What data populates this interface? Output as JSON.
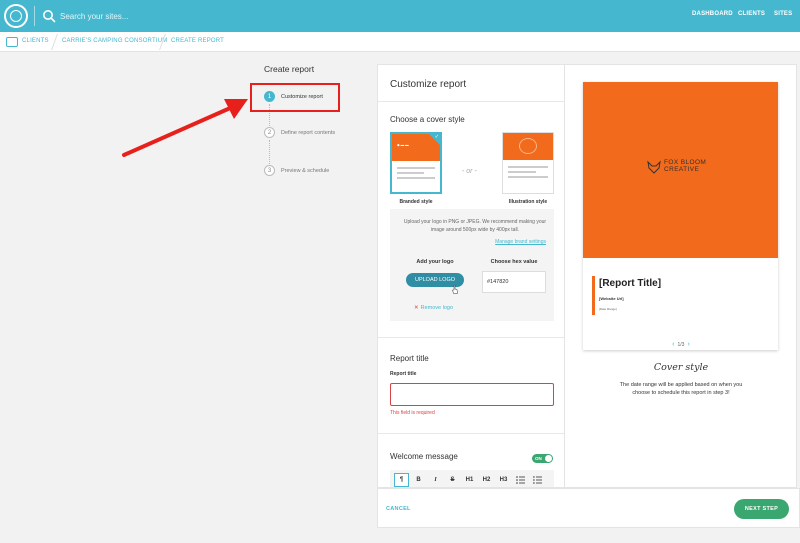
{
  "topbar": {
    "search_placeholder": "Search your sites...",
    "nav": [
      "DASHBOARD",
      "CLIENTS",
      "SITES"
    ]
  },
  "breadcrumb": [
    "CLIENTS",
    "CARRIE'S CAMPING CONSORTIUM",
    "CREATE REPORT"
  ],
  "steps": {
    "title": "Create report",
    "items": [
      {
        "num": "1",
        "label": "Customize report"
      },
      {
        "num": "2",
        "label": "Define report contents"
      },
      {
        "num": "3",
        "label": "Preview & schedule"
      }
    ]
  },
  "panel": {
    "title": "Customize report",
    "cover_section": "Choose a cover style",
    "or": "- or -",
    "branded_label": "Branded style",
    "illustration_label": "Illustration style",
    "logo_help": "Upload your logo in PNG or JPEG. We recommend making your image around 500px wide by 400px tall.",
    "manage_link": "Manage brand settings",
    "add_logo_label": "Add your logo",
    "hex_label": "Choose hex value",
    "upload_label": "UPLOAD LOGO",
    "hex_value": "#147820",
    "remove_logo": "Remove logo",
    "report_title_section": "Report title",
    "report_title_field": "Report title",
    "error": "This field is required",
    "welcome_section": "Welcome message",
    "toggle_label": "ON",
    "toolbar": [
      "¶",
      "B",
      "I",
      "S",
      "H1",
      "H2",
      "H3",
      "list",
      "numbered-list"
    ]
  },
  "footer": {
    "cancel": "CANCEL",
    "next": "NEXT STEP"
  },
  "preview": {
    "brand_line1": "FOX BLOOM",
    "brand_line2": "CREATIVE",
    "report_title": "[Report Title]",
    "website_url": "[Website Url]",
    "date_range": "[Date Range]",
    "pager": "1/3",
    "caption": "Cover style",
    "note": "The date range will be applied based on when you choose to schedule this report in step 3!"
  },
  "colors": {
    "brand_teal": "#45b8cf",
    "cover_orange": "#f26a1b",
    "success_green": "#3aa670",
    "error_red": "#d64545",
    "annotation_red": "#e8201c"
  }
}
